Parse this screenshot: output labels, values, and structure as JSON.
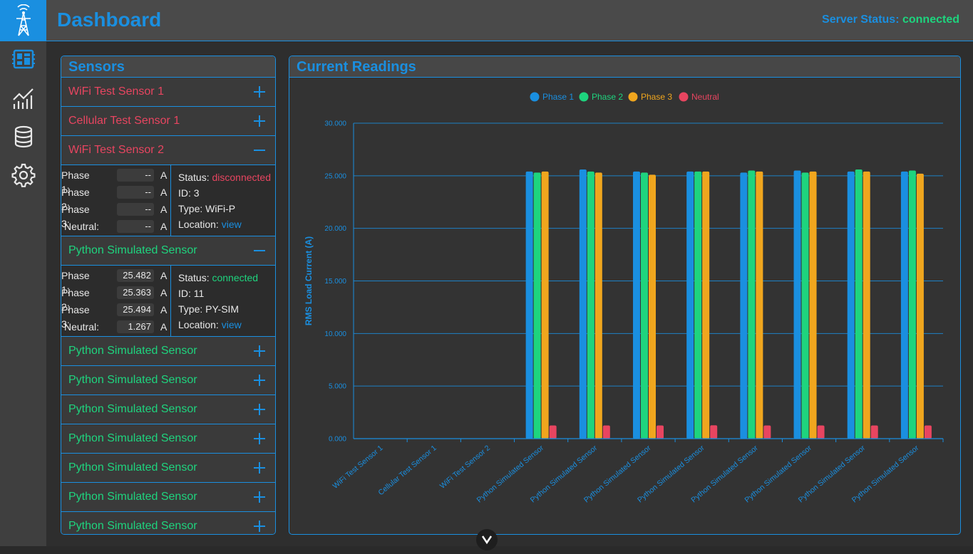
{
  "header": {
    "title": "Dashboard",
    "server_status_label": "Server Status:",
    "server_status_value": "connected"
  },
  "nav": {
    "logo_icon": "transmission-tower-icon",
    "items": [
      {
        "icon": "dashboard-icon",
        "active": true
      },
      {
        "icon": "chart-icon"
      },
      {
        "icon": "database-icon"
      },
      {
        "icon": "gear-icon"
      }
    ]
  },
  "sensors": {
    "title": "Sensors",
    "items": [
      {
        "name": "WiFi Test Sensor 1",
        "state": "disc",
        "expanded": false
      },
      {
        "name": "Cellular Test Sensor 1",
        "state": "disc",
        "expanded": false
      },
      {
        "name": "WiFi Test Sensor 2",
        "state": "disc",
        "expanded": true,
        "detail": {
          "p1": "--",
          "p2": "--",
          "p3": "--",
          "neutral": "--",
          "status": "disconnected",
          "id": "3",
          "type": "WiFi-P",
          "location": "view"
        }
      },
      {
        "name": "Python Simulated Sensor",
        "state": "conn",
        "expanded": true,
        "detail": {
          "p1": "25.482",
          "p2": "25.363",
          "p3": "25.494",
          "neutral": "1.267",
          "status": "connected",
          "id": "11",
          "type": "PY-SIM",
          "location": "view"
        }
      },
      {
        "name": "Python Simulated Sensor",
        "state": "conn",
        "expanded": false
      },
      {
        "name": "Python Simulated Sensor",
        "state": "conn",
        "expanded": false
      },
      {
        "name": "Python Simulated Sensor",
        "state": "conn",
        "expanded": false
      },
      {
        "name": "Python Simulated Sensor",
        "state": "conn",
        "expanded": false
      },
      {
        "name": "Python Simulated Sensor",
        "state": "conn",
        "expanded": false
      },
      {
        "name": "Python Simulated Sensor",
        "state": "conn",
        "expanded": false
      },
      {
        "name": "Python Simulated Sensor",
        "state": "conn",
        "expanded": false
      }
    ],
    "labels": {
      "phase1": "Phase 1:",
      "phase2": "Phase 2:",
      "phase3": "Phase 3:",
      "neutral": "Neutral:",
      "unit": "A",
      "status": "Status:",
      "id": "ID:",
      "type": "Type:",
      "location": "Location:"
    }
  },
  "chart_panel": {
    "title": "Current Readings"
  },
  "chart_data": {
    "type": "bar",
    "ylabel": "RMS Load Current (A)",
    "ylim": [
      0,
      30
    ],
    "yticks": [
      "0.000",
      "5.000",
      "10.000",
      "15.000",
      "20.000",
      "25.000",
      "30.000"
    ],
    "legend_position": "top",
    "categories": [
      "WiFi Test Sensor 1",
      "Cellular Test Sensor 1",
      "WiFi Test Sensor 2",
      "Python Simulated Sensor",
      "Python Simulated Sensor",
      "Python Simulated Sensor",
      "Python Simulated Sensor",
      "Python Simulated Sensor",
      "Python Simulated Sensor",
      "Python Simulated Sensor",
      "Python Simulated Sensor"
    ],
    "series": [
      {
        "name": "Phase 1",
        "color": "#1a8fe0",
        "values": [
          0,
          0,
          0,
          25.4,
          25.6,
          25.4,
          25.4,
          25.3,
          25.5,
          25.4,
          25.4
        ]
      },
      {
        "name": "Phase 2",
        "color": "#1ed47e",
        "values": [
          0,
          0,
          0,
          25.3,
          25.4,
          25.3,
          25.4,
          25.5,
          25.3,
          25.6,
          25.5
        ]
      },
      {
        "name": "Phase 3",
        "color": "#f0a61e",
        "values": [
          0,
          0,
          0,
          25.4,
          25.3,
          25.1,
          25.4,
          25.4,
          25.4,
          25.4,
          25.2
        ]
      },
      {
        "name": "Neutral",
        "color": "#e84560",
        "values": [
          0,
          0,
          0,
          1.25,
          1.25,
          1.25,
          1.27,
          1.25,
          1.25,
          1.25,
          1.25
        ]
      }
    ]
  }
}
